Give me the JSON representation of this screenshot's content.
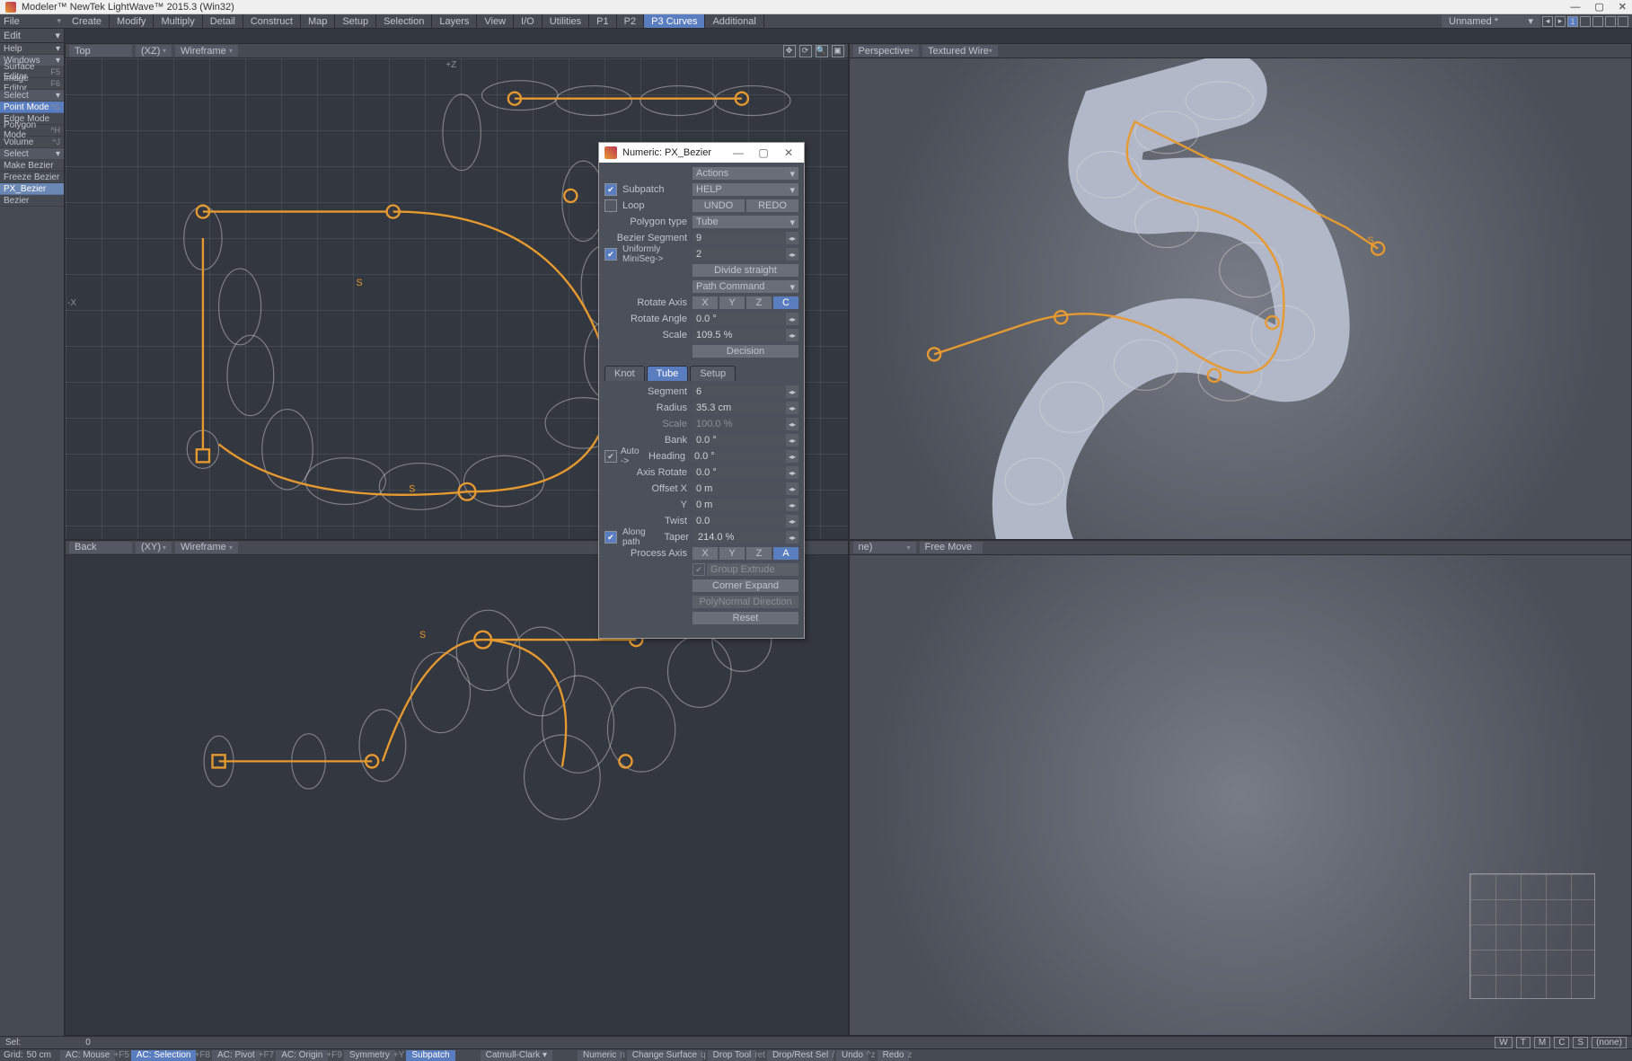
{
  "title": "Modeler™ NewTek LightWave™ 2015.3  (Win32)",
  "file_menu": {
    "file": "File",
    "edit": "Edit",
    "help": "Help",
    "windows": "Windows"
  },
  "menu_tabs": [
    "Create",
    "Modify",
    "Multiply",
    "Detail",
    "Construct",
    "Map",
    "Setup",
    "Selection",
    "Layers",
    "View",
    "I/O",
    "Utilities",
    "P1",
    "P2",
    "P3 Curves",
    "Additional"
  ],
  "active_tab_index": 14,
  "file_label": "Unnamed *",
  "left_panel": {
    "editors": [
      {
        "label": "Surface Editor",
        "sc": "F5"
      },
      {
        "label": "Image Editor",
        "sc": "F6"
      }
    ],
    "select_hdr": "Select",
    "modes": [
      {
        "label": "Point Mode",
        "sc": "^G",
        "sel": true
      },
      {
        "label": "Edge Mode",
        "sc": ""
      },
      {
        "label": "Polygon Mode",
        "sc": "^H"
      },
      {
        "label": "Volume",
        "sc": "^J"
      }
    ],
    "tools_hdr": "Select",
    "tools": [
      "Make Bezier",
      "Freeze Bezier",
      "PX_Bezier",
      "Bezier"
    ],
    "tool_sel": 2
  },
  "viewports": {
    "tl": {
      "label": "Top",
      "axes": "(XZ)",
      "mode": "Wireframe"
    },
    "tr": {
      "label": "Perspective",
      "mode": "Textured Wire"
    },
    "bl": {
      "label": "Back",
      "axes": "(XY)",
      "mode": "Wireframe"
    },
    "br": {
      "label": "ne)",
      "mode": "Free Move"
    }
  },
  "dialog": {
    "title": "Numeric: PX_Bezier",
    "actions": "Actions",
    "subpatch": "Subpatch",
    "loop": "Loop",
    "help": "HELP",
    "undo": "UNDO",
    "redo": "REDO",
    "polytype_lbl": "Polygon type",
    "polytype": "Tube",
    "bezseg_lbl": "Bezier Segment",
    "bezseg": "9",
    "uniminiseg_lbl": "Uniformly MiniSeg->",
    "uniminiseg": "2",
    "divstraight": "Divide straight",
    "pathcmd": "Path Command",
    "rotaxis_lbl": "Rotate Axis",
    "rotangle_lbl": "Rotate Angle",
    "rotangle": "0.0 °",
    "scale_lbl": "Scale",
    "scale": "109.5 %",
    "decision": "Decision",
    "tabs": [
      "Knot",
      "Tube",
      "Setup"
    ],
    "tab_on": 1,
    "segment_lbl": "Segment",
    "segment": "6",
    "radius_lbl": "Radius",
    "radius": "35.3 cm",
    "scale2_lbl": "Scale",
    "scale2": "100.0 %",
    "bank_lbl": "Bank",
    "bank": "0.0 °",
    "auto": "Auto ->",
    "heading_lbl": "Heading",
    "heading": "0.0 °",
    "axisrot_lbl": "Axis Rotate",
    "axisrot": "0.0 °",
    "offx_lbl": "Offset X",
    "offx": "0 m",
    "offy_lbl": "Y",
    "offy": "0 m",
    "twist_lbl": "Twist",
    "twist": "0.0",
    "alongpath": "Along path",
    "taper_lbl": "Taper",
    "taper": "214.0 %",
    "procaxis_lbl": "Process Axis",
    "grpext": "Group Extrude",
    "cornerexp": "Corner Expand",
    "polynorm": "PolyNormal Direction",
    "reset": "Reset"
  },
  "statusA": {
    "sel_lbl": "Sel:",
    "sel_val": "0",
    "letters": [
      "W",
      "T",
      "M",
      "C",
      "S",
      "(none)"
    ]
  },
  "statusB": {
    "grid_lbl": "Grid:",
    "grid": "50 cm",
    "cells": [
      {
        "t": "AC: Mouse",
        "s": "+F5"
      },
      {
        "t": "AC: Selection",
        "s": "+F8",
        "on": true
      },
      {
        "t": "AC: Pivot",
        "s": "+F7"
      },
      {
        "t": "AC: Origin",
        "s": "+F9"
      },
      {
        "t": "Symmetry",
        "s": "+Y"
      },
      {
        "t": "Subpatch",
        "s": "",
        "on": true
      }
    ],
    "catmull": "Catmull-Clark",
    "rcells": [
      {
        "t": "Numeric",
        "s": "n"
      },
      {
        "t": "Change Surface",
        "s": "q"
      },
      {
        "t": "Drop Tool",
        "s": "ret"
      },
      {
        "t": "Drop/Rest Sel",
        "s": "/"
      },
      {
        "t": "Undo",
        "s": "^z"
      },
      {
        "t": "Redo",
        "s": "z"
      }
    ]
  }
}
